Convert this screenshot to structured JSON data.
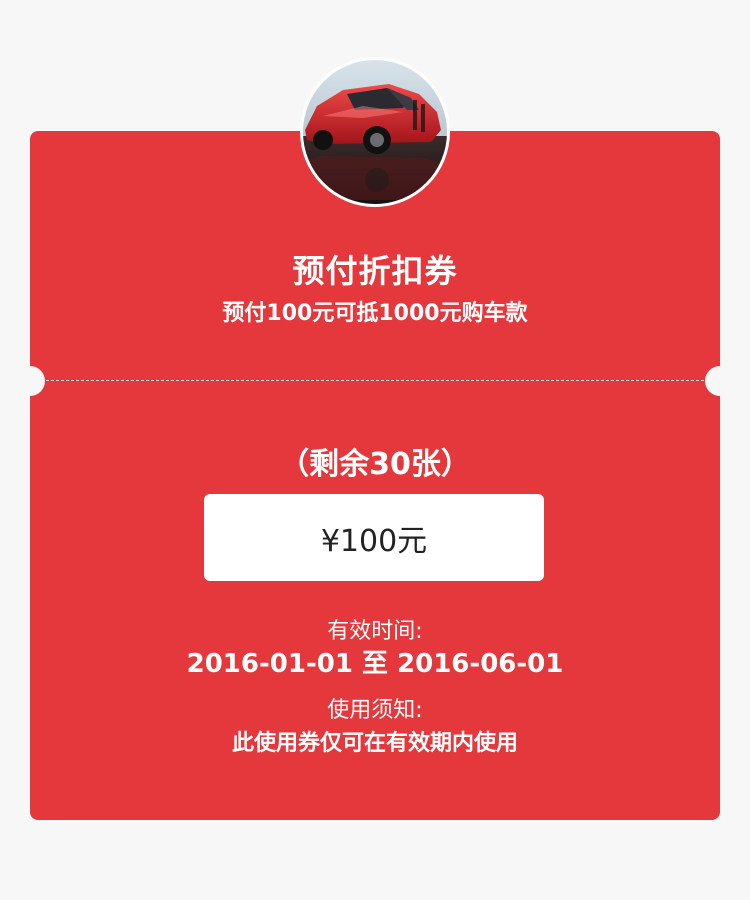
{
  "coupon": {
    "image_icon": "car-photo",
    "title": "预付折扣券",
    "subtitle": "预付100元可抵1000元购车款",
    "remaining": "（剩余30张）",
    "price": "¥100元",
    "validity_label": "有效时间:",
    "validity_value": "2016-01-01 至 2016-06-01",
    "notice_label": "使用须知:",
    "notice_value": "此使用券仅可在有效期内使用"
  },
  "colors": {
    "card_background": "#e5383d",
    "page_background": "#f7f7f7",
    "text_on_card": "#ffffff",
    "price_box": "#ffffff"
  }
}
